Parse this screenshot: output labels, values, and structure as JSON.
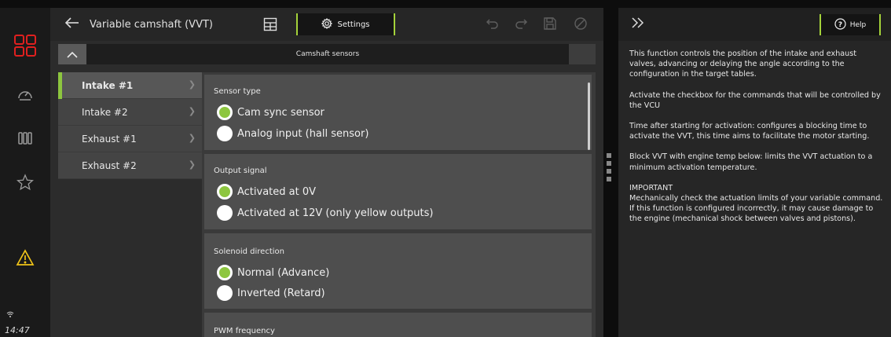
{
  "rail": {
    "clock": "14:47",
    "icons": [
      "app-grid-icon",
      "gauge-icon",
      "columns-icon",
      "star-icon",
      "warning-icon",
      "wifi-icon"
    ],
    "accent": "#e0201f",
    "warning_color": "#f0c419"
  },
  "header": {
    "title": "Variable camshaft (VVT)",
    "settings_label": "Settings"
  },
  "section": {
    "title": "Camshaft sensors"
  },
  "nav": {
    "items": [
      {
        "label": "Intake #1"
      },
      {
        "label": "Intake #2"
      },
      {
        "label": "Exhaust #1"
      },
      {
        "label": "Exhaust #2"
      }
    ]
  },
  "cards": [
    {
      "title": "Sensor type",
      "options": [
        {
          "label": "Cam sync sensor",
          "selected": true
        },
        {
          "label": "Analog input (hall sensor)",
          "selected": false
        }
      ]
    },
    {
      "title": "Output signal",
      "options": [
        {
          "label": "Activated at 0V",
          "selected": true
        },
        {
          "label": "Activated at 12V (only yellow outputs)",
          "selected": false
        }
      ]
    },
    {
      "title": "Solenoid direction",
      "options": [
        {
          "label": "Normal (Advance)",
          "selected": true
        },
        {
          "label": "Inverted (Retard)",
          "selected": false
        }
      ]
    },
    {
      "title": "PWM frequency"
    }
  ],
  "help": {
    "button_label": "Help",
    "paragraphs": [
      "This function controls the position of the intake and exhaust valves, advancing or delaying the angle according to the configuration in the target tables.",
      "Activate the checkbox for the commands that will be controlled by the VCU",
      "Time after starting for activation: configures a blocking time to activate the VVT, this time aims to facilitate the motor starting.",
      "Block VVT with engine temp below: limits the VVT actuation to a minimum activation temperature.",
      "IMPORTANT\nMechanically check the actuation limits of your variable command. If this function is configured incorrectly, it may cause damage to the engine (mechanical shock between valves and pistons)."
    ]
  },
  "colors": {
    "accent_green": "#8dc63f",
    "tab_outline": "#a4d23a"
  }
}
